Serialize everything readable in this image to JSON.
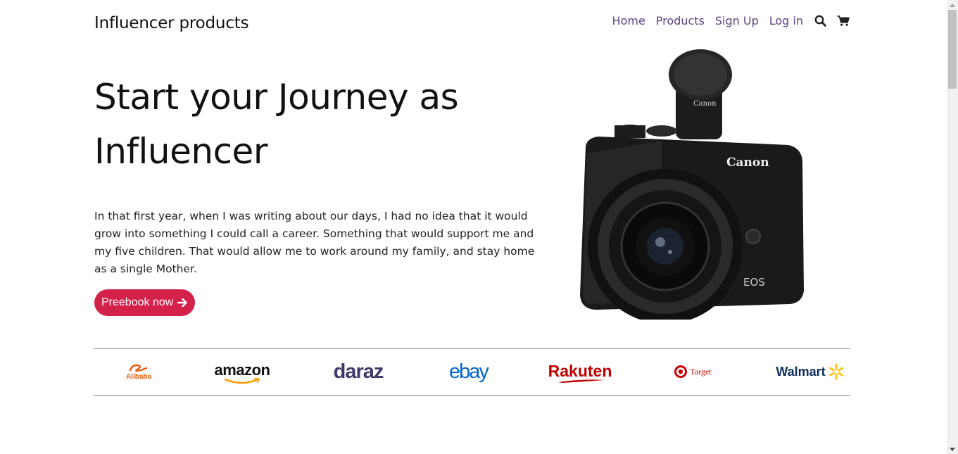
{
  "header": {
    "brand": "Influencer products",
    "nav": [
      "Home",
      "Products",
      "Sign Up",
      "Log in"
    ],
    "icons": [
      "search-icon",
      "cart-icon"
    ],
    "nav_color": "#5b3f83"
  },
  "hero": {
    "title": "Start your Journey as Influencer",
    "text": "In that first year, when I was writing about our days, I had no idea that it would grow into something I could call a career. Something that would support me and my five children. That would allow me to work around my family, and stay home as a single Mother.",
    "cta_label": "Preebook now",
    "cta_color": "#d4214a",
    "image_alt": "Canon EOS camera",
    "camera_brand": "Canon",
    "camera_model": "EOS"
  },
  "partners": {
    "logos": [
      "Alibaba",
      "amazon",
      "daraz",
      "ebay",
      "Rakuten",
      "Target",
      "Walmart"
    ]
  }
}
